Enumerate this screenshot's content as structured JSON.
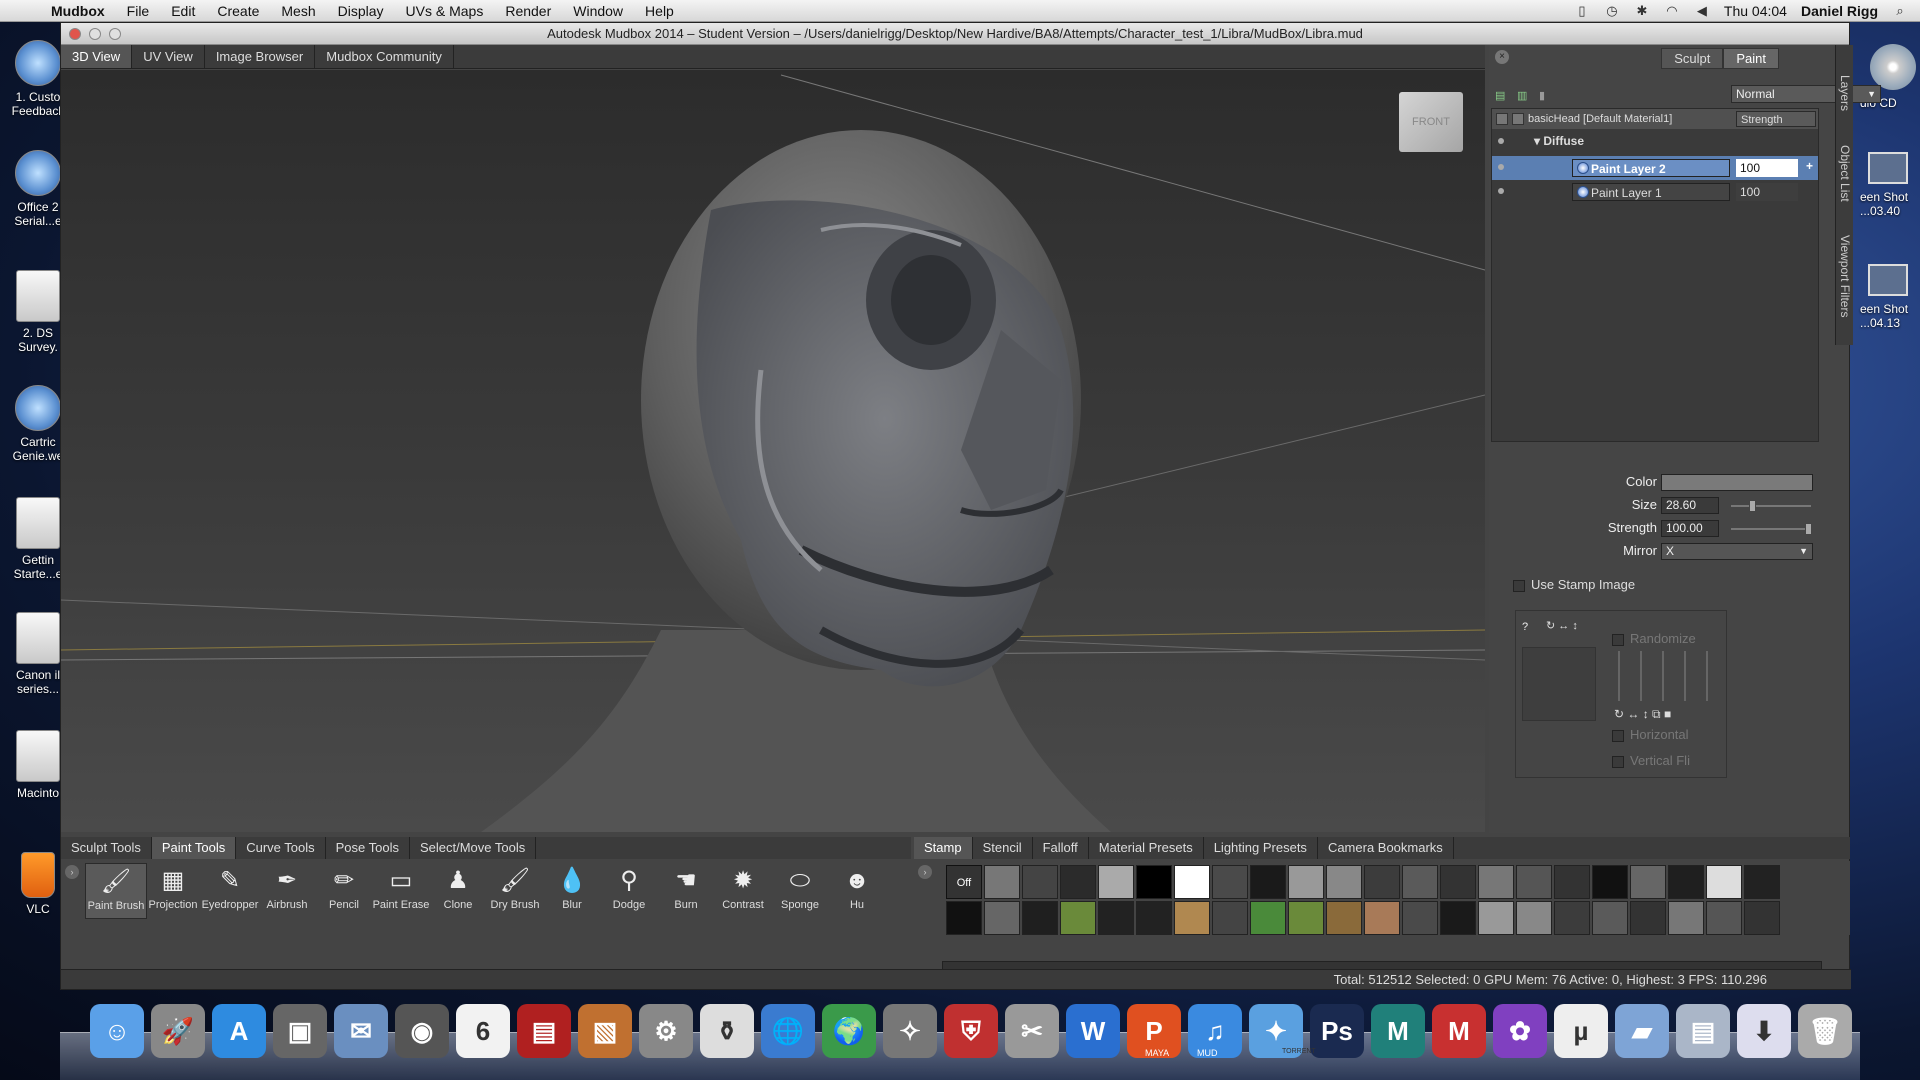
{
  "menubar": {
    "app": "Mudbox",
    "items": [
      "File",
      "Edit",
      "Create",
      "Mesh",
      "Display",
      "UVs & Maps",
      "Render",
      "Window",
      "Help"
    ],
    "clock": "Thu 04:04",
    "user": "Daniel Rigg"
  },
  "desktop_left": [
    "1. Custo\nFeedback",
    "Office 2\nSerial...e",
    "2. DS\nSurvey.",
    "Cartric\nGenie.we",
    "Gettin\nStarte...e",
    "Canon il\nseries...",
    "Macinto",
    "VLC"
  ],
  "desktop_right": [
    "dio CD",
    "een Shot\n...03.40",
    "een Shot\n...04.13"
  ],
  "window": {
    "title": "Autodesk Mudbox 2014 – Student Version – /Users/danielrigg/Desktop/New Hardive/BA8/Attempts/Character_test_1/Libra/MudBox/Libra.mud"
  },
  "view_tabs": [
    {
      "label": "3D View",
      "active": true
    },
    {
      "label": "UV View",
      "active": false
    },
    {
      "label": "Image Browser",
      "active": false
    },
    {
      "label": "Mudbox Community",
      "active": false
    }
  ],
  "viewcube": {
    "label": "FRONT"
  },
  "panel": {
    "mode_buttons": [
      {
        "label": "Sculpt",
        "active": false
      },
      {
        "label": "Paint",
        "active": true
      }
    ],
    "blend_mode": "Normal",
    "material": "basicHead [Default Material1]",
    "strength_header": "Strength",
    "channel": "Diffuse",
    "layers": [
      {
        "name": "Paint Layer 2",
        "value": "100",
        "selected": true
      },
      {
        "name": "Paint Layer 1",
        "value": "100",
        "selected": false
      }
    ],
    "side_tabs": [
      "Layers",
      "Object List",
      "Viewport Filters"
    ]
  },
  "properties": {
    "color_label": "Color",
    "size_label": "Size",
    "size_value": "28.60",
    "strength_label": "Strength",
    "strength_value": "100.00",
    "mirror_label": "Mirror",
    "mirror_value": "X",
    "use_stamp": "Use Stamp Image",
    "randomize": "Randomize",
    "horizontal": "Horizontal",
    "vertical": "Vertical Fli",
    "stamp_help": "?"
  },
  "tool_tabs": [
    {
      "label": "Sculpt Tools",
      "active": false
    },
    {
      "label": "Paint Tools",
      "active": true
    },
    {
      "label": "Curve Tools",
      "active": false
    },
    {
      "label": "Pose Tools",
      "active": false
    },
    {
      "label": "Select/Move Tools",
      "active": false
    }
  ],
  "tools": [
    {
      "label": "Paint Brush",
      "icon": "paint-brush-icon",
      "glyph": "🖌"
    },
    {
      "label": "Projection",
      "icon": "projection-icon",
      "glyph": "▦"
    },
    {
      "label": "Eyedropper",
      "icon": "eyedropper-icon",
      "glyph": "✎"
    },
    {
      "label": "Airbrush",
      "icon": "airbrush-icon",
      "glyph": "✒"
    },
    {
      "label": "Pencil",
      "icon": "pencil-icon",
      "glyph": "✏"
    },
    {
      "label": "Paint Erase",
      "icon": "eraser-icon",
      "glyph": "▭"
    },
    {
      "label": "Clone",
      "icon": "clone-stamp-icon",
      "glyph": "♟"
    },
    {
      "label": "Dry Brush",
      "icon": "dry-brush-icon",
      "glyph": "🖌"
    },
    {
      "label": "Blur",
      "icon": "blur-drop-icon",
      "glyph": "💧"
    },
    {
      "label": "Dodge",
      "icon": "dodge-icon",
      "glyph": "⚲"
    },
    {
      "label": "Burn",
      "icon": "burn-icon",
      "glyph": "☚"
    },
    {
      "label": "Contrast",
      "icon": "contrast-icon",
      "glyph": "✹"
    },
    {
      "label": "Sponge",
      "icon": "sponge-icon",
      "glyph": "⬭"
    },
    {
      "label": "Hu",
      "icon": "hue-icon",
      "glyph": "☻"
    }
  ],
  "stamp_tabs": [
    {
      "label": "Stamp",
      "active": true
    },
    {
      "label": "Stencil",
      "active": false
    },
    {
      "label": "Falloff",
      "active": false
    },
    {
      "label": "Material Presets",
      "active": false
    },
    {
      "label": "Lighting Presets",
      "active": false
    },
    {
      "label": "Camera Bookmarks",
      "active": false
    }
  ],
  "stamp_off": "Off",
  "status": "Total: 512512   Selected: 0 GPU Mem: 76   Active: 0, Highest: 3   FPS: 110.296",
  "dock": [
    {
      "icon": "finder-icon",
      "glyph": "☺",
      "color": "#5aa0e8"
    },
    {
      "icon": "launchpad-icon",
      "glyph": "🚀",
      "color": "#888"
    },
    {
      "icon": "app-store-icon",
      "glyph": "A",
      "color": "#2e8be0"
    },
    {
      "icon": "photo-booth-icon",
      "glyph": "▣",
      "color": "#666"
    },
    {
      "icon": "mail-icon",
      "glyph": "✉",
      "color": "#6a8fc0"
    },
    {
      "icon": "facetime-icon",
      "glyph": "◉",
      "color": "#555"
    },
    {
      "icon": "calendar-icon",
      "glyph": "6",
      "color": "#f2f2f2"
    },
    {
      "icon": "photo-icon",
      "glyph": "▤",
      "color": "#b02020"
    },
    {
      "icon": "iphoto-icon",
      "glyph": "▧",
      "color": "#c07030"
    },
    {
      "icon": "system-preferences-icon",
      "glyph": "⚙",
      "color": "#888"
    },
    {
      "icon": "vial-icon",
      "glyph": "⚱",
      "color": "#ddd"
    },
    {
      "icon": "network-icon",
      "glyph": "🌐",
      "color": "#3a7bd0"
    },
    {
      "icon": "globe-download-icon",
      "glyph": "🌍",
      "color": "#3a9a4a"
    },
    {
      "icon": "satellite-icon",
      "glyph": "✧",
      "color": "#777"
    },
    {
      "icon": "shield-icon",
      "glyph": "⛨",
      "color": "#c03030"
    },
    {
      "icon": "utilities-icon",
      "glyph": "✂",
      "color": "#999"
    },
    {
      "icon": "word-icon",
      "glyph": "W",
      "color": "#2a6fd0"
    },
    {
      "icon": "powerpoint-icon",
      "glyph": "P",
      "color": "#e05020"
    },
    {
      "icon": "itunes-icon",
      "glyph": "♫",
      "color": "#3a8ae0"
    },
    {
      "icon": "safari-icon",
      "glyph": "✦",
      "color": "#5aa0e0"
    },
    {
      "icon": "photoshop-icon",
      "glyph": "Ps",
      "color": "#1a2a50"
    },
    {
      "icon": "maya-icon",
      "glyph": "M",
      "color": "#20807a"
    },
    {
      "icon": "mudbox-icon",
      "glyph": "M",
      "color": "#c83030"
    },
    {
      "icon": "paint-icon",
      "glyph": "✿",
      "color": "#8040c0"
    },
    {
      "icon": "utorrent-icon",
      "glyph": "µ",
      "color": "#eee"
    },
    {
      "icon": "applications-folder-icon",
      "glyph": "▰",
      "color": "#7ea4d6"
    },
    {
      "icon": "documents-folder-icon",
      "glyph": "▤",
      "color": "#aab6c8"
    },
    {
      "icon": "downloads-icon",
      "glyph": "⬇",
      "color": "#dde"
    },
    {
      "icon": "trash-icon",
      "glyph": "🗑",
      "color": "#aaa"
    }
  ],
  "dock_labels": {
    "maya": "MAYA",
    "mud": "MUD",
    "torrent": "TORRENT"
  }
}
